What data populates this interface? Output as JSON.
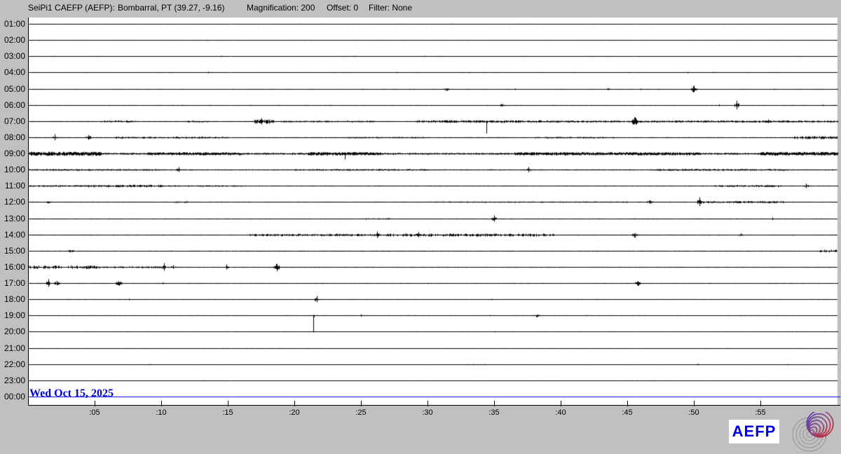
{
  "header": {
    "station": "SeiPi1 CAEFP (AEFP):",
    "location": "Bombarral, PT (39.27, -9.16)",
    "magnification": "Magnification: 200",
    "offset": "Offset: 0",
    "filter": "Filter: None"
  },
  "date_label": "Wed Oct 15, 2025",
  "branding": {
    "logo_text": "AEFP"
  },
  "colors": {
    "background": "#c0c0c0",
    "plot_bg": "#ffffff",
    "trace": "#000000",
    "accent_blue": "#0000dd",
    "logo_gray": "#9a9a9a",
    "logo_blue": "#4433bb",
    "logo_red": "#cc2233"
  },
  "x_axis": {
    "tick_labels": [
      ":05",
      ":10",
      ":15",
      ":20",
      ":25",
      ":30",
      ":35",
      ":40",
      ":45",
      ":50",
      ":55"
    ],
    "minutes_per_tick": 5
  },
  "rows": [
    {
      "label": "01:00",
      "base": 0.2,
      "density": 0.05,
      "segments": [],
      "events": []
    },
    {
      "label": "02:00",
      "base": 0.2,
      "density": 0.05,
      "segments": [],
      "events": []
    },
    {
      "label": "03:00",
      "base": 0.2,
      "density": 0.07,
      "segments": [],
      "events": [
        {
          "m": 14.5,
          "a": 1,
          "t": "dot"
        }
      ]
    },
    {
      "label": "04:00",
      "base": 0.2,
      "density": 0.07,
      "segments": [],
      "events": [
        {
          "m": 13.5,
          "a": 1.2,
          "t": "dot"
        },
        {
          "m": 27.7,
          "a": 1,
          "t": "dot"
        },
        {
          "m": 49.5,
          "a": 1.2,
          "t": "dot"
        },
        {
          "m": 51.4,
          "a": 1,
          "t": "dot"
        }
      ]
    },
    {
      "label": "05:00",
      "base": 0.25,
      "density": 0.13,
      "segments": [],
      "events": [
        {
          "m": 31.4,
          "a": 2,
          "t": "burst"
        },
        {
          "m": 36.6,
          "a": 1.2,
          "t": "dot"
        },
        {
          "m": 43.5,
          "a": 1.5,
          "t": "burst"
        },
        {
          "m": 46,
          "a": 1.2,
          "t": "dot"
        },
        {
          "m": 50,
          "a": 4,
          "t": "burst"
        },
        {
          "m": 56,
          "a": 1,
          "t": "dot"
        }
      ]
    },
    {
      "label": "06:00",
      "base": 0.25,
      "density": 0.14,
      "segments": [],
      "events": [
        {
          "m": 35.6,
          "a": 2,
          "t": "burst"
        },
        {
          "m": 51.9,
          "a": 1.5,
          "t": "dot"
        },
        {
          "m": 53.2,
          "a": 7,
          "t": "spike"
        },
        {
          "m": 59.7,
          "a": 1.2,
          "t": "dot"
        }
      ]
    },
    {
      "label": "07:00",
      "base": 0.5,
      "density": 0.5,
      "segments": [
        {
          "m0": 5.5,
          "m1": 8,
          "a": 1.2
        },
        {
          "m0": 12,
          "m1": 13.5,
          "a": 1
        },
        {
          "m0": 16.8,
          "m1": 18.5,
          "a": 2.2
        },
        {
          "m0": 19,
          "m1": 26,
          "a": 0.9
        },
        {
          "m0": 29,
          "m1": 38.5,
          "a": 1.4
        },
        {
          "m0": 38.5,
          "m1": 60.8,
          "a": 1.1
        }
      ],
      "events": [
        {
          "m": 17.5,
          "a": 5,
          "t": "spike"
        },
        {
          "m": 34.4,
          "a": 17,
          "t": "vdown"
        },
        {
          "m": 45.5,
          "a": 6,
          "t": "burst"
        },
        {
          "m": 55.6,
          "a": 3,
          "t": "spike"
        }
      ]
    },
    {
      "label": "08:00",
      "base": 0.5,
      "density": 0.45,
      "segments": [
        {
          "m0": 6.5,
          "m1": 15,
          "a": 1
        },
        {
          "m0": 24,
          "m1": 30,
          "a": 0.8
        },
        {
          "m0": 38,
          "m1": 44,
          "a": 0.8
        },
        {
          "m0": 57.5,
          "m1": 60.8,
          "a": 1.6
        }
      ],
      "events": [
        {
          "m": 2,
          "a": 5,
          "t": "spike"
        },
        {
          "m": 4.5,
          "a": 3,
          "t": "burst"
        }
      ]
    },
    {
      "label": "09:00",
      "base": 1.0,
      "density": 0.85,
      "segments": [
        {
          "m0": 0,
          "m1": 5.5,
          "a": 2.2
        },
        {
          "m0": 9,
          "m1": 16,
          "a": 1.6
        },
        {
          "m0": 21,
          "m1": 26.5,
          "a": 1.8
        },
        {
          "m0": 36.5,
          "m1": 50.5,
          "a": 1.7
        },
        {
          "m0": 55,
          "m1": 60.8,
          "a": 2
        }
      ],
      "events": [
        {
          "m": 23.8,
          "a": 8,
          "t": "vdown"
        }
      ]
    },
    {
      "label": "10:00",
      "base": 0.6,
      "density": 0.55,
      "segments": [
        {
          "m0": 0,
          "m1": 10,
          "a": 0.9
        },
        {
          "m0": 20,
          "m1": 30,
          "a": 0.9
        },
        {
          "m0": 47,
          "m1": 57,
          "a": 1
        }
      ],
      "events": [
        {
          "m": 11.3,
          "a": 4,
          "t": "spike"
        },
        {
          "m": 37.6,
          "a": 4,
          "t": "spike"
        }
      ]
    },
    {
      "label": "11:00",
      "base": 0.45,
      "density": 0.4,
      "segments": [
        {
          "m0": 0,
          "m1": 4.5,
          "a": 0.9
        },
        {
          "m0": 4.5,
          "m1": 10,
          "a": 1.4
        },
        {
          "m0": 10,
          "m1": 16,
          "a": 0.8
        },
        {
          "m0": 51.5,
          "m1": 56.6,
          "a": 1.1
        }
      ],
      "events": [
        {
          "m": 58.4,
          "a": 2.5,
          "t": "burst"
        }
      ]
    },
    {
      "label": "12:00",
      "base": 0.4,
      "density": 0.35,
      "segments": [
        {
          "m0": 10.9,
          "m1": 12.2,
          "a": 1
        },
        {
          "m0": 30,
          "m1": 45,
          "a": 0.7
        },
        {
          "m0": 50.5,
          "m1": 56.8,
          "a": 1.2
        }
      ],
      "events": [
        {
          "m": 1.5,
          "a": 1.5,
          "t": "burst"
        },
        {
          "m": 46.7,
          "a": 3,
          "t": "burst"
        },
        {
          "m": 50.4,
          "a": 7,
          "t": "spike"
        }
      ]
    },
    {
      "label": "13:00",
      "base": 0.3,
      "density": 0.25,
      "segments": [
        {
          "m0": 25.2,
          "m1": 27.2,
          "a": 0.8
        },
        {
          "m0": 45,
          "m1": 57,
          "a": 0.5
        }
      ],
      "events": [
        {
          "m": 35,
          "a": 5,
          "t": "spike"
        },
        {
          "m": 55.9,
          "a": 2,
          "t": "dot"
        }
      ]
    },
    {
      "label": "14:00",
      "base": 0.35,
      "density": 0.3,
      "segments": [
        {
          "m0": 16.6,
          "m1": 27,
          "a": 1.3
        },
        {
          "m0": 27,
          "m1": 39.5,
          "a": 1.6
        }
      ],
      "events": [
        {
          "m": 26.2,
          "a": 5,
          "t": "spike"
        },
        {
          "m": 29.3,
          "a": 4,
          "t": "spike"
        },
        {
          "m": 45.6,
          "a": 3.5,
          "t": "burst"
        },
        {
          "m": 53.5,
          "a": 1.8,
          "t": "burst"
        }
      ]
    },
    {
      "label": "15:00",
      "base": 0.3,
      "density": 0.22,
      "segments": [
        {
          "m0": 15.5,
          "m1": 58,
          "a": 0.45
        },
        {
          "m0": 59.3,
          "m1": 60.8,
          "a": 1.6
        }
      ],
      "events": [
        {
          "m": 3.2,
          "a": 2.5,
          "t": "burst"
        }
      ]
    },
    {
      "label": "16:00",
      "base": 0.3,
      "density": 0.28,
      "segments": [
        {
          "m0": 0,
          "m1": 5.5,
          "a": 1.9
        },
        {
          "m0": 5.5,
          "m1": 10,
          "a": 1
        }
      ],
      "events": [
        {
          "m": 10.2,
          "a": 6,
          "t": "spike"
        },
        {
          "m": 10.9,
          "a": 3,
          "t": "spike"
        },
        {
          "m": 14.9,
          "a": 4,
          "t": "spike"
        },
        {
          "m": 18.7,
          "a": 5,
          "t": "burst"
        }
      ]
    },
    {
      "label": "17:00",
      "base": 0.25,
      "density": 0.16,
      "segments": [],
      "events": [
        {
          "m": 1.5,
          "a": 6,
          "t": "spike"
        },
        {
          "m": 2.1,
          "a": 4,
          "t": "burst"
        },
        {
          "m": 6.8,
          "a": 4,
          "t": "burst"
        },
        {
          "m": 10.1,
          "a": 1.5,
          "t": "dot"
        },
        {
          "m": 45.8,
          "a": 3,
          "t": "burst"
        }
      ]
    },
    {
      "label": "18:00",
      "base": 0.2,
      "density": 0.1,
      "segments": [],
      "events": [
        {
          "m": 7.6,
          "a": 1.2,
          "t": "dot"
        },
        {
          "m": 21.7,
          "a": 5,
          "t": "spike"
        },
        {
          "m": 34.8,
          "a": 1,
          "t": "dot"
        }
      ]
    },
    {
      "label": "19:00",
      "base": 0.2,
      "density": 0.09,
      "segments": [],
      "events": [
        {
          "m": 21.4,
          "a": 24,
          "t": "vdown"
        },
        {
          "m": 25,
          "a": 2,
          "t": "dot"
        },
        {
          "m": 34.7,
          "a": 1,
          "t": "dot"
        },
        {
          "m": 38.2,
          "a": 2,
          "t": "burst"
        }
      ]
    },
    {
      "label": "20:00",
      "base": 0.15,
      "density": 0.05,
      "segments": [],
      "events": []
    },
    {
      "label": "21:00",
      "base": 0.15,
      "density": 0.04,
      "segments": [],
      "events": []
    },
    {
      "label": "22:00",
      "base": 0.15,
      "density": 0.05,
      "segments": [],
      "events": [
        {
          "m": 50.3,
          "a": 1.2,
          "t": "dot"
        }
      ]
    },
    {
      "label": "23:00",
      "base": 0.15,
      "density": 0.04,
      "segments": [],
      "events": []
    },
    {
      "label": "00:00",
      "base": 0,
      "density": 0,
      "segments": [],
      "events": [],
      "blue": true
    }
  ]
}
